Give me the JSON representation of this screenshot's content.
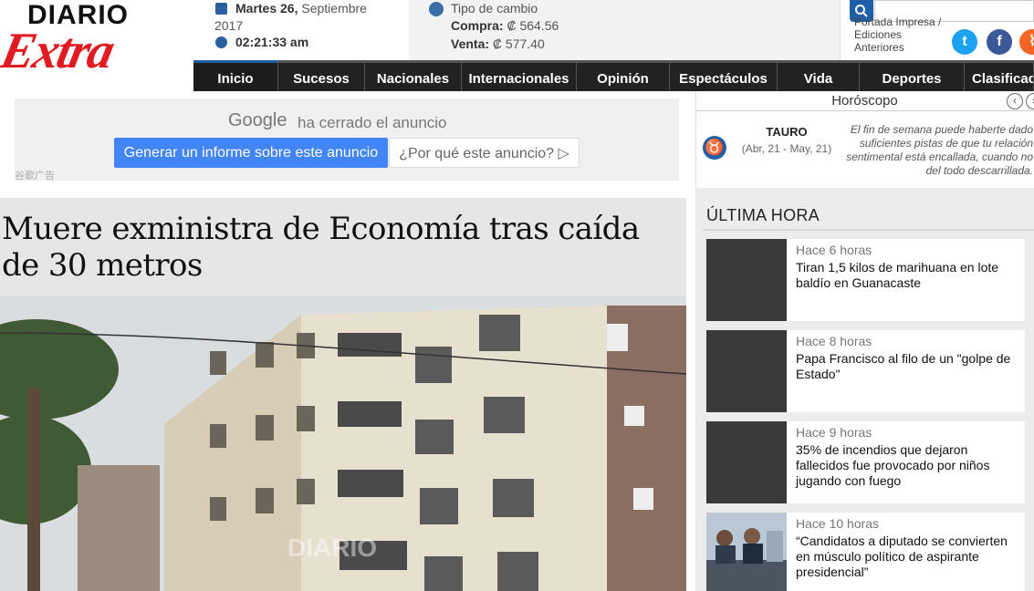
{
  "logo": {
    "top": "DIARIO",
    "bottom": "Extra"
  },
  "date": {
    "weekday": "Martes 26,",
    "month": "Septiembre",
    "year": "2017",
    "time": "02:21:33 am"
  },
  "exchange": {
    "title": "Tipo de cambio",
    "buy_label": "Compra:",
    "buy_value": "₡ 564.56",
    "sell_label": "Venta:",
    "sell_value": "₡ 577.40"
  },
  "header_links": {
    "portada": "Portada Impresa /",
    "ediciones": "Ediciones",
    "anteriores": "Anteriores"
  },
  "social": [
    {
      "icon": "twitter-icon",
      "glyph": "t",
      "color": "#1da1f2"
    },
    {
      "icon": "facebook-icon",
      "glyph": "f",
      "color": "#3b5998"
    },
    {
      "icon": "rss-icon",
      "glyph": "⌇",
      "color": "#f26522"
    }
  ],
  "nav": [
    {
      "label": "Inicio",
      "active": true
    },
    {
      "label": "Sucesos"
    },
    {
      "label": "Nacionales"
    },
    {
      "label": "Internacionales"
    },
    {
      "label": "Opinión"
    },
    {
      "label": "Espectáculos"
    },
    {
      "label": "Vida"
    },
    {
      "label": "Deportes"
    },
    {
      "label": "Clasificados"
    }
  ],
  "ad": {
    "google": "Google",
    "closed": "ha cerrado el anuncio",
    "report": "Generar un informe sobre este anuncio",
    "why": "¿Por qué este anuncio? ▷",
    "small": "谷歌广告"
  },
  "horoscope": {
    "title": "Horóscopo",
    "prev": "‹",
    "next": "›",
    "sign": "TAURO",
    "dates": "(Abr, 21 - May, 21)",
    "text": "El fin de semana puede haberte dado suficientes pistas de que tu relación sentimental está encallada, cuando no del todo descarrillada."
  },
  "article": {
    "headline": "Muere exministra de Economía tras caída de 30 metros",
    "watermark": "DIARIO Extra"
  },
  "latest": {
    "title": "ÚLTIMA HORA",
    "items": [
      {
        "time": "Hace 6 horas",
        "title": "Tiran 1,5 kilos de marihuana en lote baldío en Guanacaste"
      },
      {
        "time": "Hace 8 horas",
        "title": "Papa Francisco al filo de un \"golpe de Estado\""
      },
      {
        "time": "Hace 9 horas",
        "title": "35% de incendios que dejaron fallecidos fue provocado por niños jugando con fuego"
      },
      {
        "time": "Hace 10 horas",
        "title": "“Candidatos a diputado se convierten en músculo político de aspirante presidencial”"
      }
    ]
  },
  "colors": {
    "brand_red": "#e01b22",
    "brand_blue": "#1f5fa8",
    "nav_bg": "#222222"
  }
}
